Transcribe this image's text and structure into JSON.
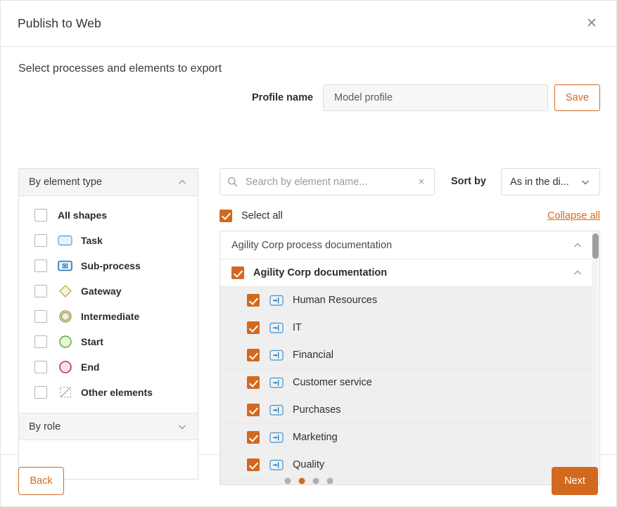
{
  "window": {
    "title": "Publish to Web",
    "close_icon": "close-icon"
  },
  "content": {
    "subtitle": "Select processes and elements to export"
  },
  "profile": {
    "label": "Profile name",
    "value": "Model profile",
    "placeholder": "Profile name",
    "save_label": "Save"
  },
  "filters": {
    "element_type": {
      "header": "By element type",
      "expanded": true,
      "items": [
        {
          "label": "All shapes",
          "icon": "none",
          "checked": false
        },
        {
          "label": "Task",
          "icon": "task-shape-icon",
          "checked": false
        },
        {
          "label": "Sub-process",
          "icon": "subprocess-shape-icon",
          "checked": false
        },
        {
          "label": "Gateway",
          "icon": "gateway-shape-icon",
          "checked": false
        },
        {
          "label": "Intermediate",
          "icon": "intermediate-event-icon",
          "checked": false
        },
        {
          "label": "Start",
          "icon": "start-event-icon",
          "checked": false
        },
        {
          "label": "End",
          "icon": "end-event-icon",
          "checked": false
        },
        {
          "label": "Other elements",
          "icon": "other-elements-icon",
          "checked": false
        }
      ]
    },
    "role": {
      "header": "By role",
      "expanded": false
    }
  },
  "search": {
    "placeholder": "Search by element name...",
    "value": "",
    "clear_label": "×"
  },
  "sort": {
    "label": "Sort by",
    "value": "As in the di..."
  },
  "list_controls": {
    "select_all_label": "Select all",
    "select_all_checked": true,
    "collapse_all_label": "Collapse all"
  },
  "tree": {
    "root": {
      "label": "Agility Corp process documentation",
      "expanded": true
    },
    "group": {
      "label": "Agility Corp documentation",
      "checked": true,
      "expanded": true
    },
    "items": [
      {
        "label": "Human Resources",
        "checked": true,
        "icon": "call-activity-icon"
      },
      {
        "label": "IT",
        "checked": true,
        "icon": "call-activity-icon"
      },
      {
        "label": "Financial",
        "checked": true,
        "icon": "call-activity-icon"
      },
      {
        "label": "Customer service",
        "checked": true,
        "icon": "call-activity-icon"
      },
      {
        "label": "Purchases",
        "checked": true,
        "icon": "call-activity-icon"
      },
      {
        "label": "Marketing",
        "checked": true,
        "icon": "call-activity-icon"
      },
      {
        "label": "Quality",
        "checked": true,
        "icon": "call-activity-icon"
      }
    ]
  },
  "footer": {
    "back_label": "Back",
    "next_label": "Next",
    "steps_total": 4,
    "active_step": 2
  },
  "colors": {
    "accent": "#d2691e",
    "row_selected_bg": "#efefef",
    "panel_header_bg": "#f5f5f5",
    "border": "#e0e0e0"
  }
}
